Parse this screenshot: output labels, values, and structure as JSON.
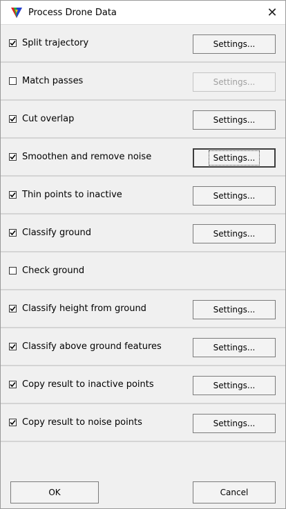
{
  "window": {
    "title": "Process Drone Data",
    "icon": "app-logo-icon",
    "close_label": "✕"
  },
  "steps": [
    {
      "label": "Split trajectory",
      "checked": true,
      "settings_label": "Settings...",
      "settings_enabled": true
    },
    {
      "label": "Match passes",
      "checked": false,
      "settings_label": "Settings...",
      "settings_enabled": false
    },
    {
      "label": "Cut overlap",
      "checked": true,
      "settings_label": "Settings...",
      "settings_enabled": true
    },
    {
      "label": "Smoothen and remove noise",
      "checked": true,
      "settings_label": "Settings...",
      "settings_enabled": true,
      "focused": true
    },
    {
      "label": "Thin points to inactive",
      "checked": true,
      "settings_label": "Settings...",
      "settings_enabled": true
    },
    {
      "label": "Classify ground",
      "checked": true,
      "settings_label": "Settings...",
      "settings_enabled": true
    },
    {
      "label": "Check ground",
      "checked": false,
      "settings_label": "",
      "settings_enabled": false
    },
    {
      "label": "Classify height from ground",
      "checked": true,
      "settings_label": "Settings...",
      "settings_enabled": true
    },
    {
      "label": "Classify above ground features",
      "checked": true,
      "settings_label": "Settings...",
      "settings_enabled": true
    },
    {
      "label": "Copy result to inactive points",
      "checked": true,
      "settings_label": "Settings...",
      "settings_enabled": true
    },
    {
      "label": "Copy result to noise points",
      "checked": true,
      "settings_label": "Settings...",
      "settings_enabled": true
    }
  ],
  "footer": {
    "ok_label": "OK",
    "cancel_label": "Cancel"
  },
  "colors": {
    "background": "#f0f0f0",
    "disabled_text": "#a0a0a0",
    "logo_red": "#e02020",
    "logo_green": "#20b040",
    "logo_blue": "#2040d0"
  }
}
